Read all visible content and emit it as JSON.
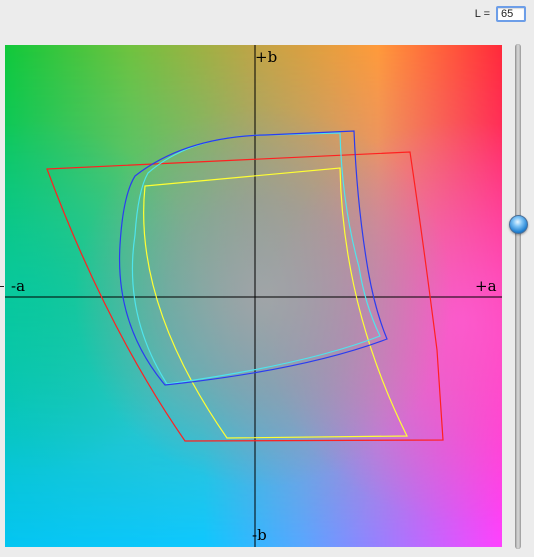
{
  "l_control": {
    "label": "L =",
    "value": "65"
  },
  "plot": {
    "axis_labels": {
      "plus_b": "+b",
      "minus_b": "-b",
      "minus_a": "-a",
      "plus_a": "+a"
    },
    "gamut_colors": {
      "red": "#ff2020",
      "yellow": "#ffff33",
      "blue": "#2b3cf0",
      "cyan": "#4fe4ec"
    }
  },
  "slider": {
    "level": 0.65
  }
}
